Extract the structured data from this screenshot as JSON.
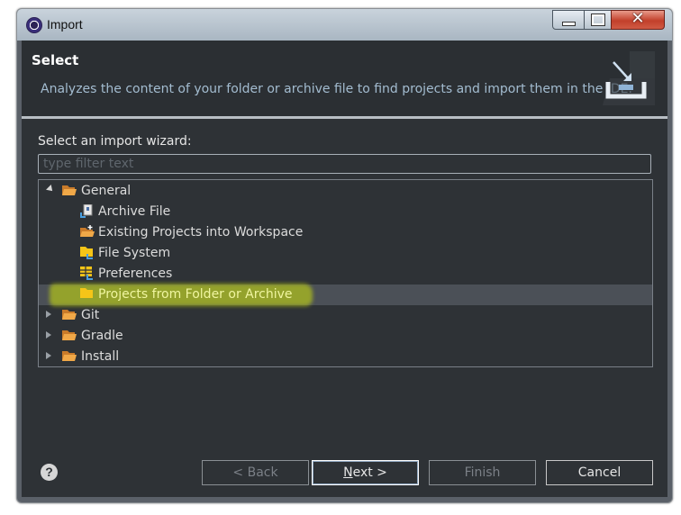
{
  "window": {
    "title": "Import",
    "app_icon": "eclipse-icon"
  },
  "header": {
    "title": "Select",
    "description": "Analyzes the content of your folder or archive file to find projects and import them in the IDE.",
    "icon": "import-wizard-banner-icon"
  },
  "wizard": {
    "label": "Select an import wizard:",
    "filter_placeholder": "type filter text",
    "filter_value": ""
  },
  "tree": [
    {
      "label": "General",
      "level": 0,
      "expanded": true,
      "icon": "folder-open-icon"
    },
    {
      "label": "Archive File",
      "level": 1,
      "icon": "archive-file-icon"
    },
    {
      "label": "Existing Projects into Workspace",
      "level": 1,
      "icon": "existing-projects-icon"
    },
    {
      "label": "File System",
      "level": 1,
      "icon": "file-system-icon"
    },
    {
      "label": "Preferences",
      "level": 1,
      "icon": "preferences-icon"
    },
    {
      "label": "Projects from Folder or Archive",
      "level": 1,
      "icon": "folder-icon",
      "selected": true
    },
    {
      "label": "Git",
      "level": 0,
      "expanded": false,
      "icon": "folder-open-icon"
    },
    {
      "label": "Gradle",
      "level": 0,
      "expanded": false,
      "icon": "folder-open-icon"
    },
    {
      "label": "Install",
      "level": 0,
      "expanded": false,
      "icon": "folder-open-icon"
    }
  ],
  "footer": {
    "help": "?",
    "back": "< Back",
    "next_mnemonic": "N",
    "next_rest": "ext >",
    "finish": "Finish",
    "cancel": "Cancel"
  },
  "colors": {
    "highlight": "#d2e60a",
    "selected_row": "#4b5057",
    "dialog_bg": "#2e3236",
    "folder": "#f0a848"
  }
}
